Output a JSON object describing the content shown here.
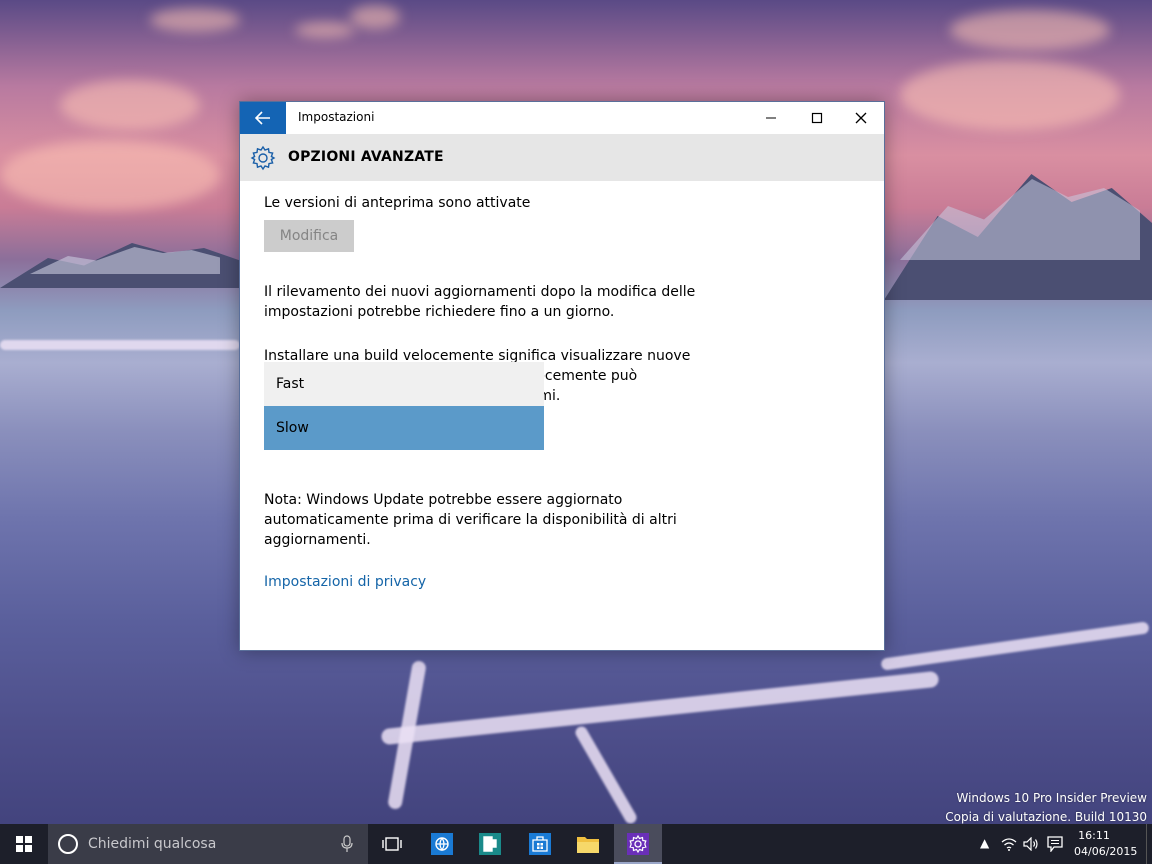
{
  "window": {
    "title": "Impostazioni",
    "page_title": "OPZIONI AVANZATE"
  },
  "content": {
    "preview_status": "Le versioni di anteprima sono attivate",
    "modify_label": "Modifica",
    "detection_text": "Il rilevamento dei nuovi aggiornamenti dopo la modifica delle impostazioni potrebbe richiedere fino a un giorno.",
    "install_text": "Installare una build velocemente significa visualizzare nuove cose prima, ma installare una build velocemente può significare anche riscontrare più problemi.",
    "dropdown": {
      "options": [
        "Fast",
        "Slow"
      ],
      "selected": "Slow"
    },
    "note_text": "Nota: Windows Update potrebbe essere aggiornato automaticamente prima di verificare la disponibilità di altri aggiornamenti.",
    "privacy_link": "Impostazioni di privacy"
  },
  "watermark": {
    "line1": "Windows 10 Pro Insider Preview",
    "line2": "Copia di valutazione. Build 10130"
  },
  "taskbar": {
    "search_placeholder": "Chiedimi qualcosa",
    "time": "16:11",
    "date": "04/06/2015",
    "apps": [
      "task-view-icon",
      "ie-icon",
      "reader-icon",
      "store-icon",
      "file-explorer-icon",
      "settings-icon"
    ]
  }
}
